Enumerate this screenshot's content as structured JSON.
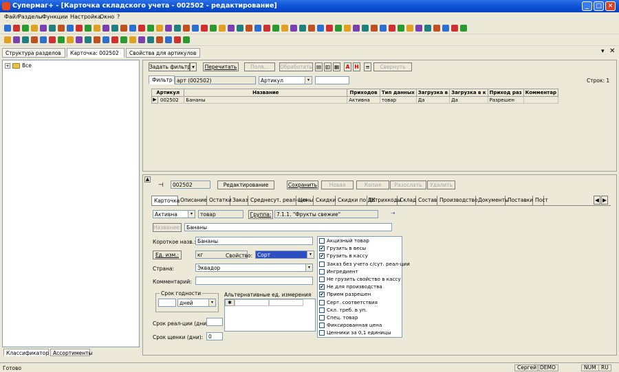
{
  "window": {
    "title": "Супермаг+ - [Карточка складского учета - 002502 - редактирование]"
  },
  "menu": [
    "Файл",
    "Разделы",
    "Функции",
    "Настройка",
    "Окно",
    "?"
  ],
  "doc_tabs": [
    "Структура разделов",
    "Карточка: 002502",
    "Свойства для артикулов"
  ],
  "tree": {
    "root": "Все"
  },
  "left_tabs": [
    "Классификатор",
    "Ассортименты"
  ],
  "filter_toolbar": {
    "set_filter": "Задать фильтр",
    "reread": "Перечитать",
    "fields": "Поля...",
    "process": "Обработать",
    "color_a": "A",
    "color_h": "H",
    "collapse": "Свернуть"
  },
  "filter_row": {
    "tab": "Фильтр",
    "value": "арт (002502)",
    "field": "Артикул",
    "rows": "Строк: 1"
  },
  "grid": {
    "headers": [
      "Артикул",
      "Название",
      "Приходов",
      "Тип данных",
      "Загрузка в",
      "Загрузка в к",
      "Приход раз",
      "Комментар"
    ],
    "rows": [
      [
        "002502",
        "Бананы",
        "Активна",
        "товар",
        "Да",
        "Да",
        "Разрешен",
        ""
      ]
    ]
  },
  "card_toolbar": {
    "code": "002502",
    "mode": "Редактирование",
    "save": "Сохранить",
    "new": "Новая",
    "copy": "Копия",
    "send": "Разослать",
    "delete": "Удалить"
  },
  "card_tabs": [
    "Карточка",
    "Описание",
    "Остатки",
    "Заказ",
    "Среднесут. реал-ция",
    "Цены",
    "Скидки",
    "Скидки по ДК",
    "Штрихкоды",
    "Склад",
    "Состав",
    "Производство",
    "Документы",
    "Поставки",
    "Пост"
  ],
  "card": {
    "status": "Активна",
    "type": "товар",
    "group_btn": "Группа:",
    "group": "7.1.1. \"Фрукты свежие\"",
    "name_label": "Название:",
    "name": "Бананы",
    "short_label": "Короткое назв.:",
    "short": "Бананы",
    "unit_btn": "Ед. изм.:",
    "unit": "кг",
    "prop_label": "Свойство:",
    "prop": "Сорт",
    "country_label": "Страна:",
    "country": "Эквадор",
    "comment_label": "Комментарий:",
    "comment": "",
    "shelf_group": "Срок годности",
    "shelf_unit": "дней",
    "alt_units_label": "Альтернативные ед. измерения",
    "realization_label": "Срок реал-ции (дни):",
    "realization": "",
    "delay_label": "Срок щенки (дни):",
    "delay": "0"
  },
  "checks": [
    {
      "label": "Акцизный товар",
      "on": false
    },
    {
      "label": "Грузить в весы",
      "on": true
    },
    {
      "label": "Грузить в кассу",
      "on": true
    },
    {
      "label": "Заказ без учета с/сут. реал-ции",
      "on": false
    },
    {
      "label": "Ингредиент",
      "on": false
    },
    {
      "label": "Не грузить свойство в кассу",
      "on": false
    },
    {
      "label": "Не для производства",
      "on": true
    },
    {
      "label": "Прием разрешен",
      "on": true
    },
    {
      "label": "Серт. соответствия",
      "on": false
    },
    {
      "label": "Скл. треб. в уп.",
      "on": false
    },
    {
      "label": "Спец. товар",
      "on": false
    },
    {
      "label": "Фиксированная цена",
      "on": false
    },
    {
      "label": "Ценники за 0,1 единицы",
      "on": false
    }
  ],
  "status_bar": {
    "ready": "Готово",
    "user": "Сергей",
    "db": "DEMO",
    "num": "NUM",
    "lang": "RU"
  }
}
